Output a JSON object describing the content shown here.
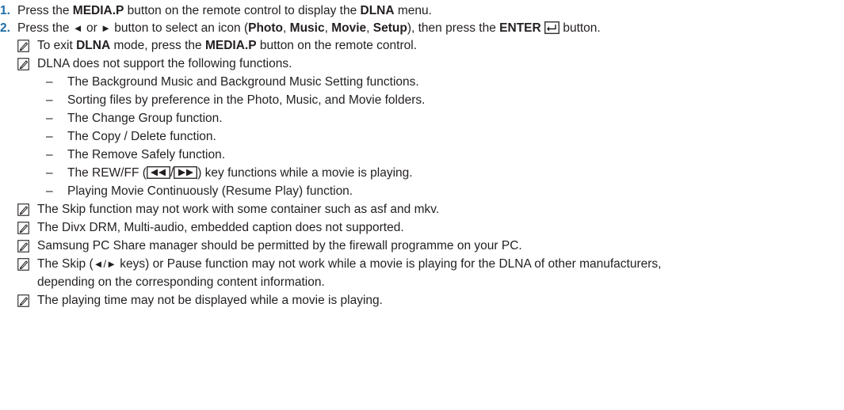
{
  "steps": [
    {
      "num": "1.",
      "parts": [
        "Press the ",
        "MEDIA.P",
        " button on the remote control to display the ",
        "DLNA",
        " menu."
      ]
    },
    {
      "num": "2.",
      "parts": [
        "Press the ",
        "◄",
        " or ",
        "►",
        " button to select an icon (",
        "Photo",
        ", ",
        "Music",
        ", ",
        "Movie",
        ", ",
        "Setup",
        "), then press the ",
        "ENTER",
        " button."
      ],
      "enter_icon": "enter-return-icon"
    }
  ],
  "notes": {
    "icon": "note-pencil-icon",
    "exit": [
      "To exit ",
      "DLNA",
      " mode, press the ",
      "MEDIA.P",
      " button on the remote control."
    ],
    "unsupported_intro": "DLNA does not support the following functions.",
    "unsupported_items": [
      "The Background Music and Background Music Setting functions.",
      "Sorting files by preference in the Photo, Music, and Movie folders.",
      "The Change Group function.",
      "The Copy / Delete function.",
      "The Remove Safely function."
    ],
    "rew_ff": [
      "The REW/FF (",
      "/",
      ") key functions while a movie is playing."
    ],
    "resume_play": "Playing Movie Continuously (Resume Play) function.",
    "skip_container": "The Skip function may not work with some container such as asf and mkv.",
    "divx": "The Divx DRM, Multi-audio, embedded caption does not supported.",
    "pc_share": "Samsung PC Share manager should be permitted by the firewall programme on your PC.",
    "skip_pause": [
      "The Skip (",
      "◄/►",
      " keys) or Pause function may not work while a movie is playing for the DLNA of other manufacturers,"
    ],
    "skip_pause_cont": "depending on the corresponding content information.",
    "playing_time": "The playing time may not be displayed while a movie is playing."
  },
  "dash_char": "–",
  "colors": {
    "step_number": "#1e6ea7",
    "text": "#231f20"
  }
}
